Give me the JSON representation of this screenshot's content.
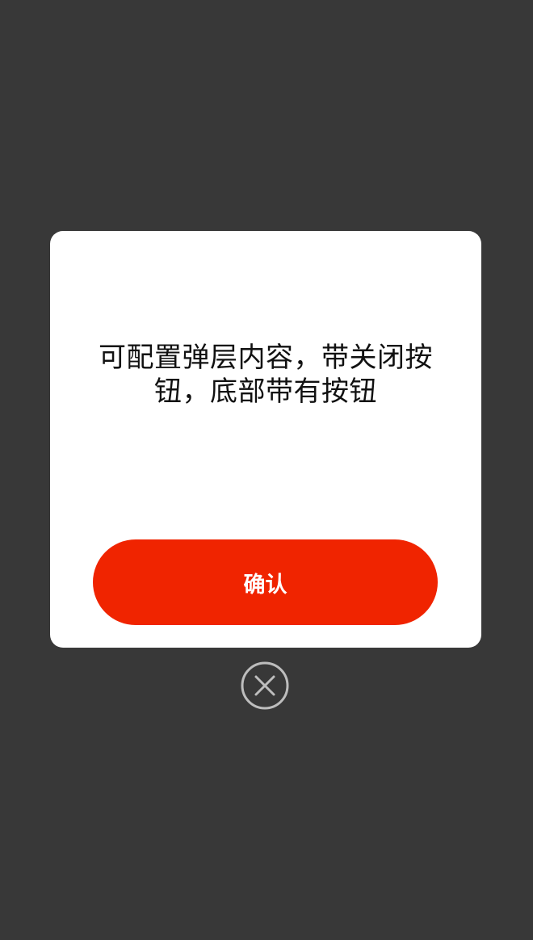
{
  "modal": {
    "content_text": "可配置弹层内容，带关闭按钮，底部带有按钮",
    "confirm_label": "确认"
  },
  "close": {
    "icon": "close-circle-icon",
    "aria_label": "关闭"
  },
  "colors": {
    "overlay": "#383838",
    "modal_bg": "#ffffff",
    "accent": "#f02400",
    "close_icon": "#bdbdbd"
  }
}
